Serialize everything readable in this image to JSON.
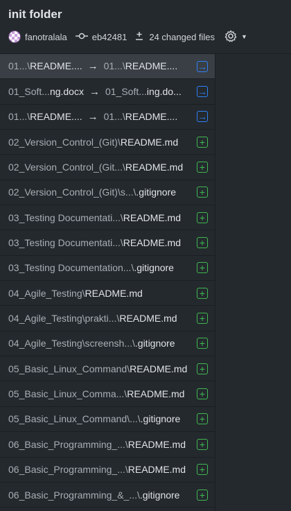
{
  "commit": {
    "title": "init folder",
    "author": "fanotralala",
    "sha": "eb42481",
    "changed_files": "24 changed files"
  },
  "icons": {
    "avatar": "avatar-icon",
    "commit": "git-commit-icon",
    "diff": "diff-icon",
    "gear": "gear-icon",
    "caret": "chevron-down-icon",
    "added": "file-added-icon",
    "renamed": "file-renamed-icon"
  },
  "colors": {
    "added": "#3fb950",
    "renamed": "#2f81f7",
    "background": "#24292e",
    "selected": "#3a3f45"
  },
  "files": [
    {
      "from_dir": "01...\\",
      "from_file": "README....",
      "to_dir": "01...\\",
      "to_file": "README....",
      "status": "renamed",
      "selected": true
    },
    {
      "from_dir": "01_Soft...",
      "from_file": "ng.docx",
      "to_dir": "01_Soft...",
      "to_file": "ing.do...",
      "status": "renamed",
      "selected": false
    },
    {
      "from_dir": "01...\\",
      "from_file": "README....",
      "to_dir": "01...\\",
      "to_file": "README....",
      "status": "renamed",
      "selected": false
    },
    {
      "dir": "02_Version_Control_(Git)\\",
      "file": "README.md",
      "status": "added"
    },
    {
      "dir": "02_Version_Control_(Git...\\",
      "file": "README.md",
      "status": "added"
    },
    {
      "dir": "02_Version_Control_(Git)\\s...\\",
      "file": ".gitignore",
      "status": "added"
    },
    {
      "dir": "03_Testing Documentati...\\",
      "file": "README.md",
      "status": "added"
    },
    {
      "dir": "03_Testing Documentati...\\",
      "file": "README.md",
      "status": "added"
    },
    {
      "dir": "03_Testing Documentation...\\",
      "file": ".gitignore",
      "status": "added"
    },
    {
      "dir": "04_Agile_Testing\\",
      "file": "README.md",
      "status": "added"
    },
    {
      "dir": "04_Agile_Testing\\prakti...\\",
      "file": "README.md",
      "status": "added"
    },
    {
      "dir": "04_Agile_Testing\\screensh...\\",
      "file": ".gitignore",
      "status": "added"
    },
    {
      "dir": "05_Basic_Linux_Command\\",
      "file": "README.md",
      "status": "added"
    },
    {
      "dir": "05_Basic_Linux_Comma...\\",
      "file": "README.md",
      "status": "added"
    },
    {
      "dir": "05_Basic_Linux_Command\\...\\",
      "file": ".gitignore",
      "status": "added"
    },
    {
      "dir": "06_Basic_Programming_...\\",
      "file": "README.md",
      "status": "added"
    },
    {
      "dir": "06_Basic_Programming_...\\",
      "file": "README.md",
      "status": "added"
    },
    {
      "dir": "06_Basic_Programming_&_...\\",
      "file": ".gitignore",
      "status": "added"
    },
    {
      "dir": "",
      "file": "",
      "status": "added"
    }
  ]
}
